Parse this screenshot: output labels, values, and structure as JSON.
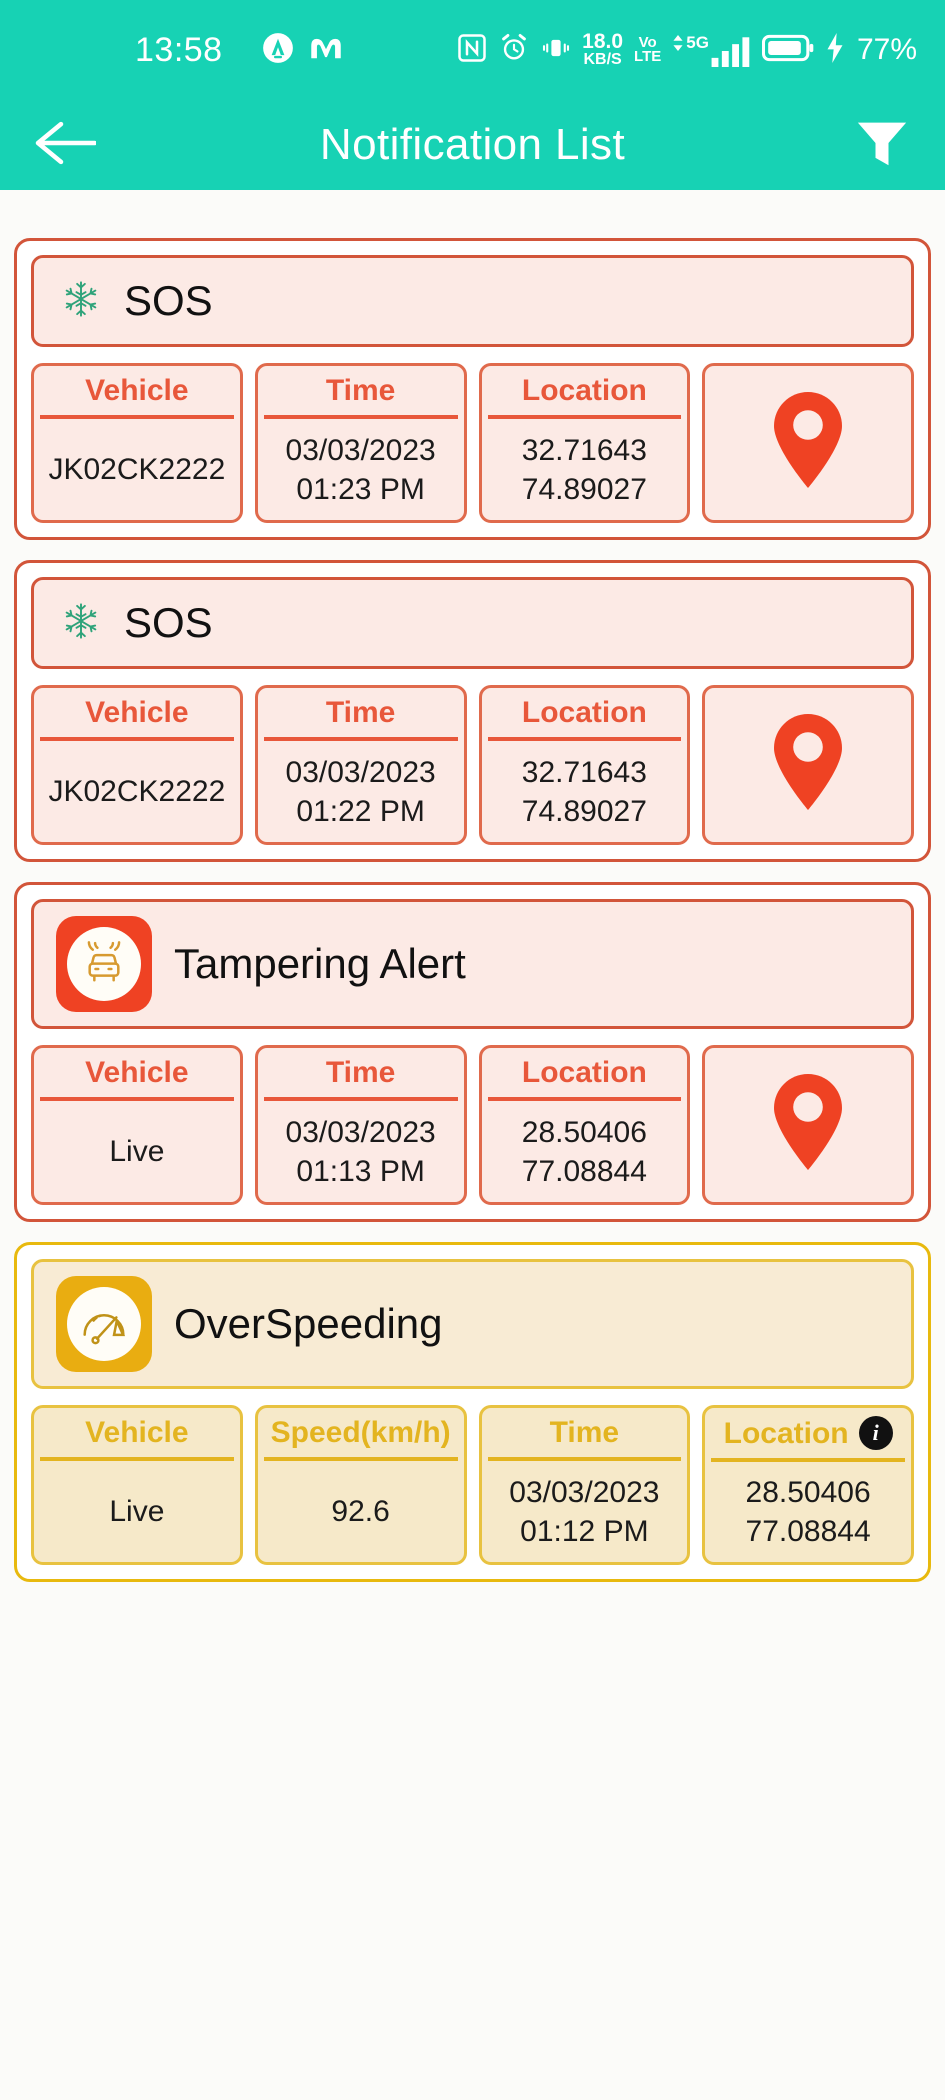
{
  "status_bar": {
    "time": "13:58",
    "notification_icons": [
      "app-a-icon",
      "app-m-icon"
    ],
    "nfc_icon": "nfc-icon",
    "alarm_icon": "alarm-icon",
    "vibrate_icon": "vibrate-icon",
    "data_rate_value": "18.0",
    "data_rate_unit": "KB/S",
    "volte_line1": "Vo",
    "volte_line2": "LTE",
    "network_type": "5G",
    "signal_icon": "signal-bars-icon",
    "battery_icon": "battery-icon",
    "charging_icon": "charging-bolt-icon",
    "battery_percent": "77%"
  },
  "app_bar": {
    "back_icon": "back-arrow-icon",
    "title": "Notification List",
    "filter_icon": "filter-icon"
  },
  "colors": {
    "brand_teal": "#17d2b4",
    "alert_red": "#ef4223",
    "alert_red_border": "#d2553a",
    "alert_red_bg": "#fceae5",
    "alert_header_text": "#e8573a",
    "amber": "#e9ad11",
    "amber_border": "#e8c240",
    "amber_bg": "#f6e9c9",
    "page_bg": "#fbfbf9"
  },
  "notifications": [
    {
      "type": "SOS",
      "title": "SOS",
      "icon": "snowflake-icon",
      "theme": "red",
      "columns": [
        {
          "header": "Vehicle",
          "value": "JK02CK2222"
        },
        {
          "header": "Time",
          "value": "03/03/2023\n01:23 PM"
        },
        {
          "header": "Location",
          "value": "32.71643\n74.89027"
        }
      ],
      "map_pin": "map-pin-icon",
      "has_info_badge": false
    },
    {
      "type": "SOS",
      "title": "SOS",
      "icon": "snowflake-icon",
      "theme": "red",
      "columns": [
        {
          "header": "Vehicle",
          "value": "JK02CK2222"
        },
        {
          "header": "Time",
          "value": "03/03/2023\n01:22 PM"
        },
        {
          "header": "Location",
          "value": "32.71643\n74.89027"
        }
      ],
      "map_pin": "map-pin-icon",
      "has_info_badge": false
    },
    {
      "type": "Tampering Alert",
      "title": "Tampering Alert",
      "icon": "car-tamper-icon",
      "theme": "red",
      "columns": [
        {
          "header": "Vehicle",
          "value": "Live"
        },
        {
          "header": "Time",
          "value": "03/03/2023\n01:13 PM"
        },
        {
          "header": "Location",
          "value": "28.50406\n77.08844"
        }
      ],
      "map_pin": "map-pin-icon",
      "has_info_badge": false
    },
    {
      "type": "OverSpeeding",
      "title": "OverSpeeding",
      "icon": "speedometer-icon",
      "theme": "amber",
      "columns": [
        {
          "header": "Vehicle",
          "value": "Live"
        },
        {
          "header": "Speed(km/h)",
          "value": "92.6"
        },
        {
          "header": "Time",
          "value": "03/03/2023\n01:12 PM"
        },
        {
          "header": "Location",
          "value": "28.50406\n77.08844",
          "info_badge": "i"
        }
      ],
      "map_pin": null,
      "has_info_badge": true
    }
  ]
}
